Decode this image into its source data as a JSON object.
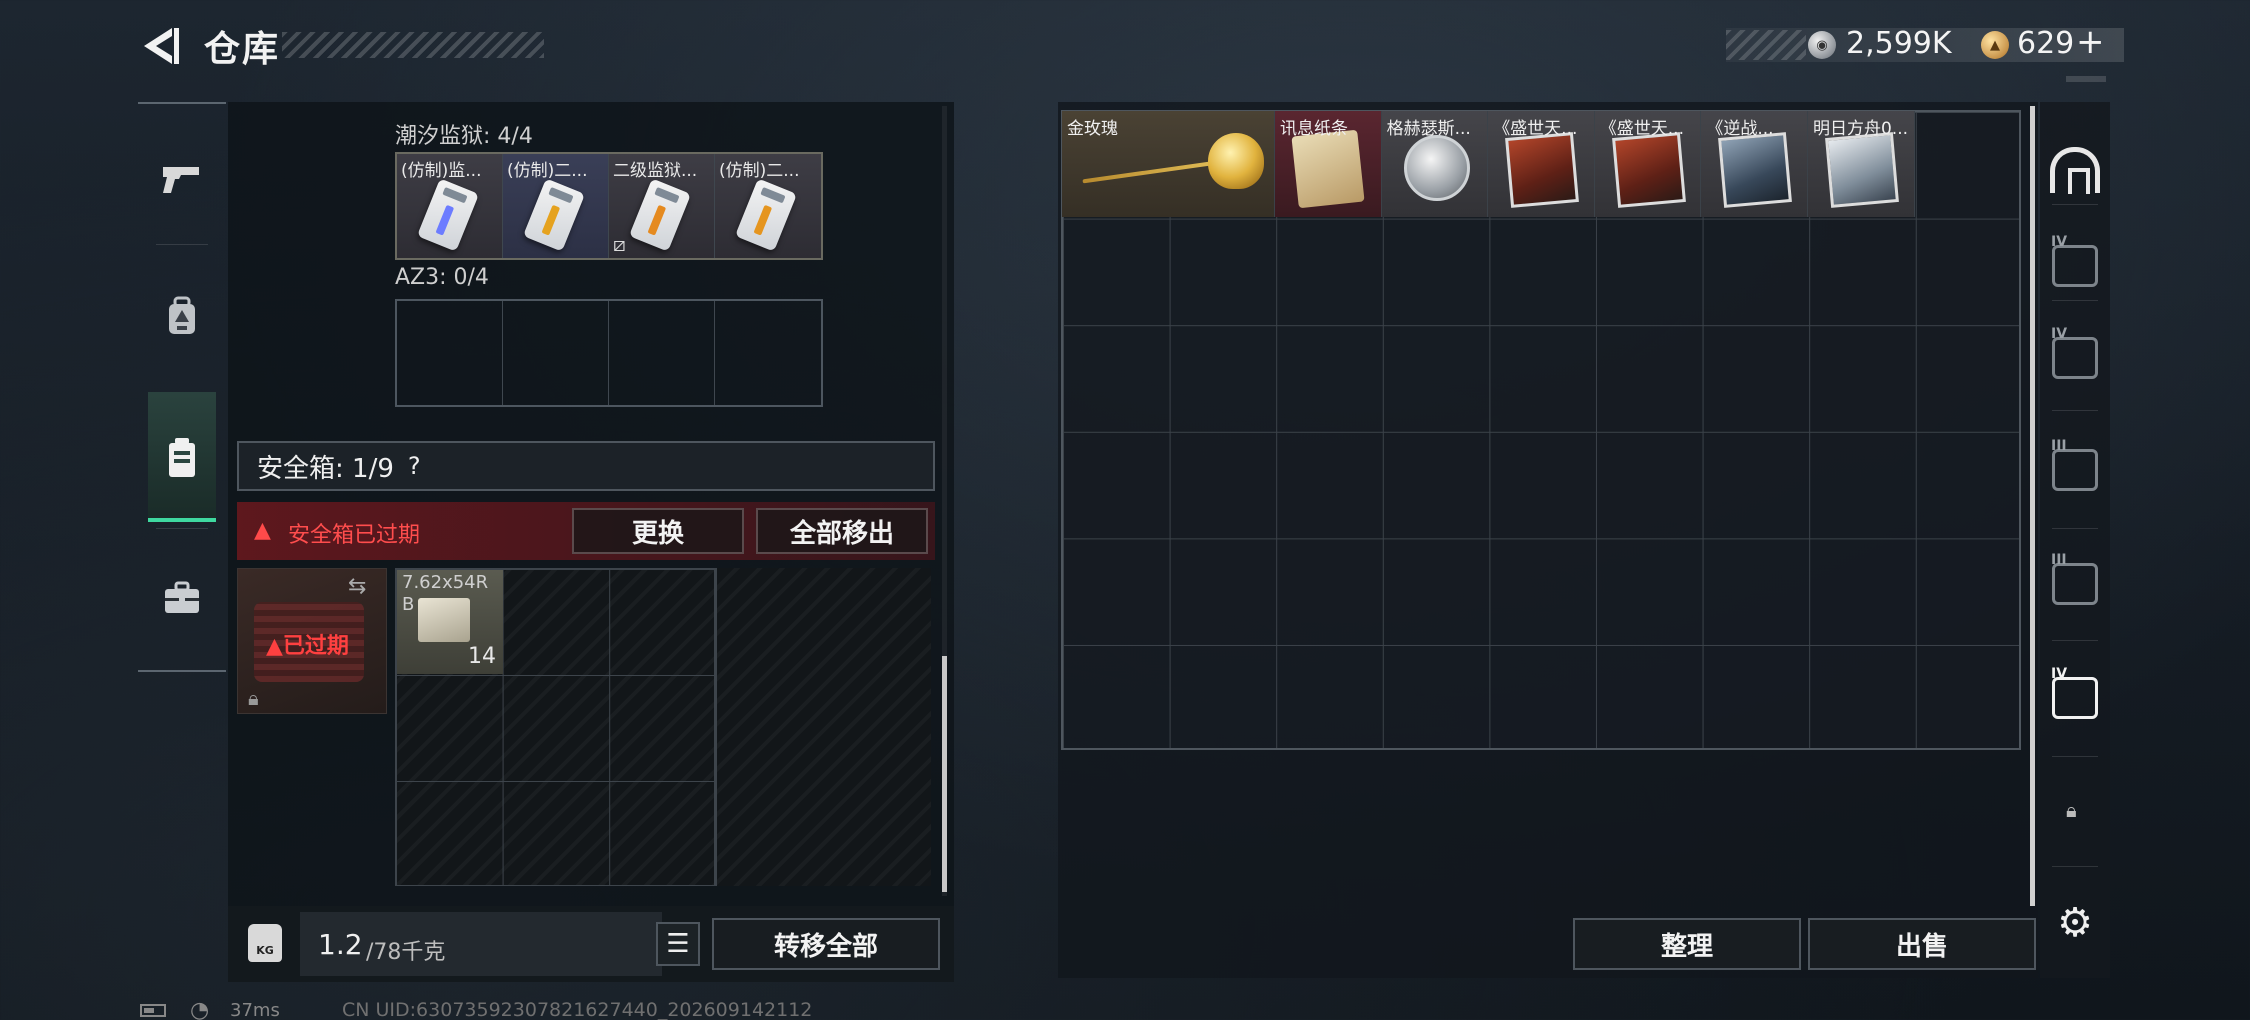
{
  "header": {
    "title": "仓库",
    "currency_silver": "2,599K",
    "currency_gold": "629",
    "gold_add": "+"
  },
  "left_tabs": [
    {
      "icon": "pistol-icon"
    },
    {
      "icon": "backpack-icon"
    },
    {
      "icon": "safebox-icon",
      "active": true
    },
    {
      "icon": "briefcase-icon"
    }
  ],
  "container": {
    "tidal_prison_label": "潮汐监狱: 4/4",
    "tidal_slots": [
      "(仿制)监...",
      "(仿制)二...",
      "二级监狱...",
      "(仿制)二..."
    ],
    "az3_label": "AZ3: 0/4"
  },
  "safebox": {
    "label": "安全箱: 1/9",
    "help": "?",
    "expired_warning": "安全箱已过期",
    "replace_button": "更换",
    "move_all_out_button": "全部移出",
    "expired_tag": "已过期",
    "ammo_label": "7.62x54R B",
    "ammo_count": "14"
  },
  "weight": {
    "icon_text": "KG",
    "current": "1.2",
    "max": "/78千克"
  },
  "transfer_all_button": "转移全部",
  "storage": {
    "items": [
      {
        "name": "金玫瑰",
        "kind": "rose"
      },
      {
        "name": "讯息纸条",
        "kind": "scroll"
      },
      {
        "name": "格赫瑟斯...",
        "kind": "medal"
      },
      {
        "name": "《盛世天...",
        "kind": "book-fire"
      },
      {
        "name": "《盛世天...",
        "kind": "book-fire"
      },
      {
        "name": "《逆战...",
        "kind": "book-ice"
      },
      {
        "name": "明日方舟0...",
        "kind": "book-pale"
      }
    ],
    "organize_button": "整理",
    "sell_button": "出售"
  },
  "right_tabs": [
    {
      "icon": "home-storage-icon",
      "num": ""
    },
    {
      "icon": "storage-tab-icon",
      "num": "IV"
    },
    {
      "icon": "storage-tab-icon",
      "num": "IV"
    },
    {
      "icon": "storage-tab-icon",
      "num": "III"
    },
    {
      "icon": "storage-tab-icon",
      "num": "III"
    },
    {
      "icon": "storage-tab-icon",
      "num": "IV",
      "active": true
    }
  ],
  "status": {
    "ping": "37ms",
    "uid": "CN UID:63073592307821627440_202609142112"
  },
  "colors": {
    "accent_green": "#3fd9a0",
    "warning_red": "#ff4d4d"
  }
}
